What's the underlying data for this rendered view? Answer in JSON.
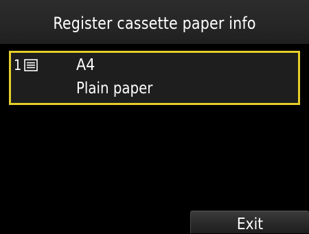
{
  "title": "Register cassette paper info",
  "cassette": {
    "slot_number": "1",
    "icon": "paper-cassette-icon",
    "paper_size": "A4",
    "paper_type": "Plain paper"
  },
  "buttons": {
    "exit_label": "Exit"
  },
  "colors": {
    "background": "#000000",
    "title_bar": "#262626",
    "selection_border": "#e6cf2b",
    "text": "#ffffff"
  }
}
